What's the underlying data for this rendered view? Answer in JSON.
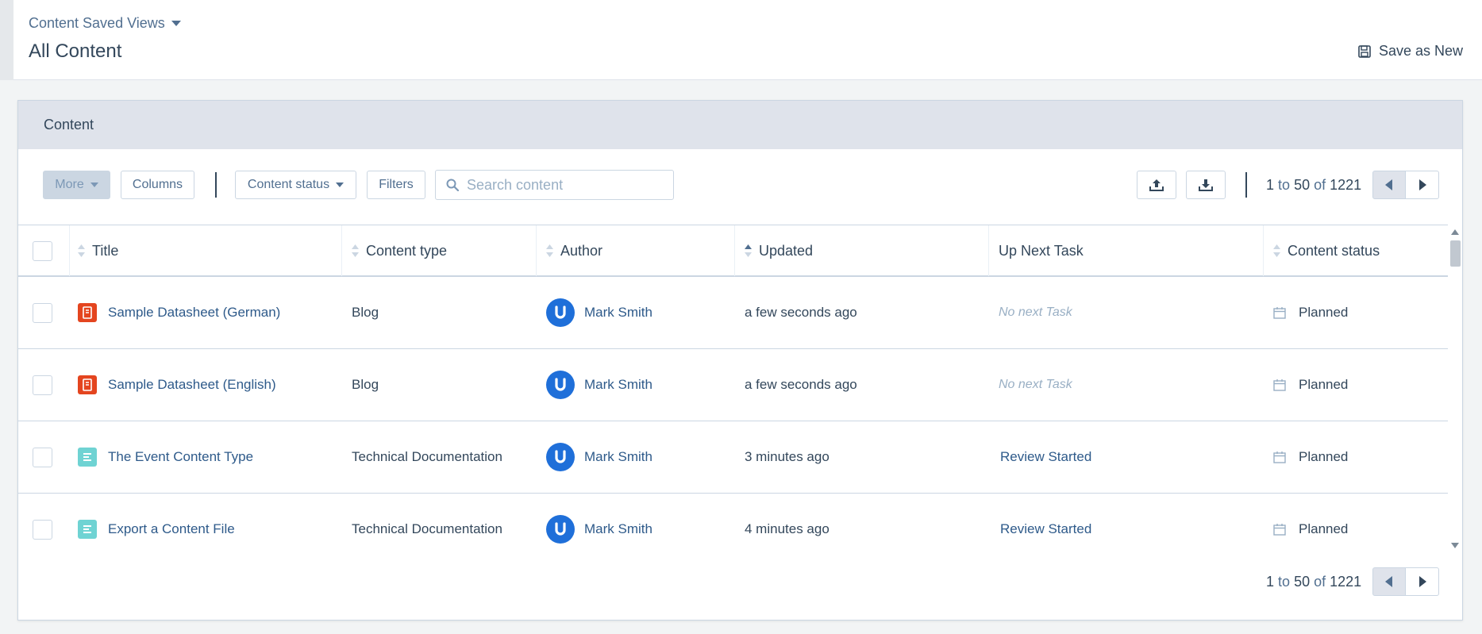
{
  "header": {
    "saved_views_label": "Content Saved Views",
    "title": "All Content",
    "save_as_new": "Save as New"
  },
  "card": {
    "title": "Content"
  },
  "toolbar": {
    "more": "More",
    "columns": "Columns",
    "content_status": "Content status",
    "filters": "Filters",
    "search_placeholder": "Search content"
  },
  "pagination": {
    "start": "1",
    "to": "to",
    "end": "50",
    "of": "of",
    "total": "1221"
  },
  "table": {
    "columns": [
      "Title",
      "Content type",
      "Author",
      "Updated",
      "Up Next Task",
      "Content status"
    ],
    "rows": [
      {
        "title": "Sample Datasheet (German)",
        "icon": "datasheet-icon",
        "icon_color": "#e4451f",
        "type": "Blog",
        "author": "Mark Smith",
        "updated": "a few seconds ago",
        "task": "No next Task",
        "status": "Planned"
      },
      {
        "title": "Sample Datasheet (English)",
        "icon": "datasheet-icon",
        "icon_color": "#e4451f",
        "type": "Blog",
        "author": "Mark Smith",
        "updated": "a few seconds ago",
        "task": "No next Task",
        "status": "Planned"
      },
      {
        "title": "The Event Content Type",
        "icon": "document-lines-icon",
        "icon_color": "#6fd3d3",
        "type": "Technical Documentation",
        "author": "Mark Smith",
        "updated": "3 minutes ago",
        "task": "Review Started",
        "status": "Planned"
      },
      {
        "title": "Export a Content File",
        "icon": "document-lines-icon",
        "icon_color": "#6fd3d3",
        "type": "Technical Documentation",
        "author": "Mark Smith",
        "updated": "4 minutes ago",
        "task": "Review Started",
        "status": "Planned"
      }
    ]
  },
  "colors": {
    "avatar": "#1f6fd9",
    "link": "#2e5a8a",
    "header_bg": "#dfe3eb"
  }
}
